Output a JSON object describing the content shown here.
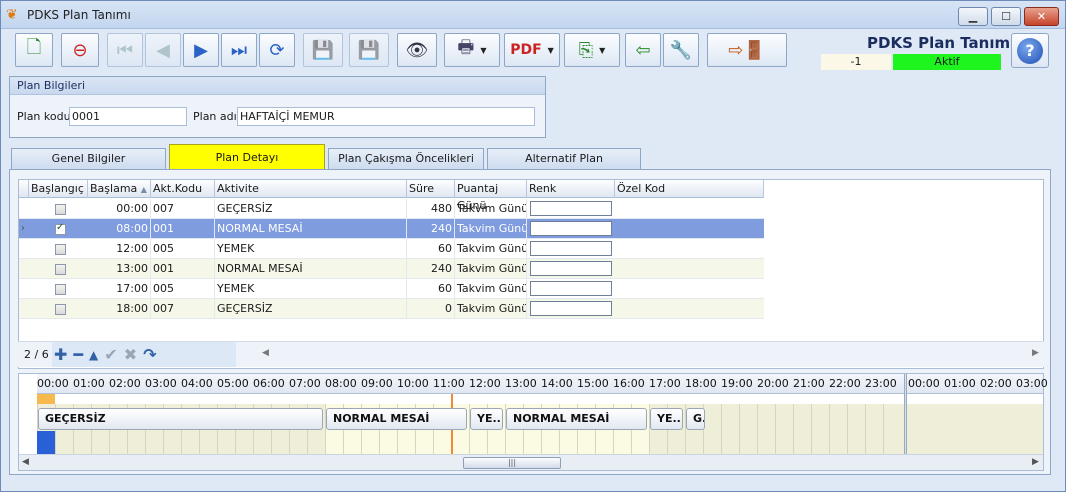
{
  "window": {
    "title": "PDKS Plan Tanımı"
  },
  "header": {
    "title": "PDKS Plan Tanımı",
    "record_no": "-1",
    "status": "Aktif",
    "status_color": "#1ef51e"
  },
  "toolbar": {
    "icons": [
      "new-icon",
      "delete-icon",
      "first-icon",
      "prev-icon",
      "next-icon",
      "last-icon",
      "refresh-icon",
      "save-icon",
      "save-cancel-icon",
      "preview-icon",
      "print-icon",
      "pdf-export-icon",
      "copy-icon",
      "import-icon",
      "tools-icon",
      "exit-icon",
      "help-icon"
    ]
  },
  "plan_info": {
    "group_title": "Plan Bilgileri",
    "code_label": "Plan kodu",
    "code_value": "0001",
    "name_label": "Plan adı",
    "name_value": "HAFTAİÇİ MEMUR"
  },
  "tabs": [
    "Genel Bilgiler",
    "Plan Detayı",
    "Plan Çakışma Öncelikleri",
    "Alternatif Plan"
  ],
  "grid": {
    "columns": [
      "Başlangıç",
      "Başlama",
      "Akt.Kodu",
      "Aktivite",
      "Süre",
      "Puantaj Günü",
      "Renk",
      "Özel Kod"
    ],
    "rows": [
      {
        "start": false,
        "time": "00:00",
        "code": "007",
        "activity": "GEÇERSİZ",
        "dur": "480",
        "day": "Takvim Günü"
      },
      {
        "start": true,
        "time": "08:00",
        "code": "001",
        "activity": "NORMAL MESAİ",
        "dur": "240",
        "day": "Takvim Günü"
      },
      {
        "start": false,
        "time": "12:00",
        "code": "005",
        "activity": "YEMEK",
        "dur": "60",
        "day": "Takvim Günü"
      },
      {
        "start": false,
        "time": "13:00",
        "code": "001",
        "activity": "NORMAL MESAİ",
        "dur": "240",
        "day": "Takvim Günü"
      },
      {
        "start": false,
        "time": "17:00",
        "code": "005",
        "activity": "YEMEK",
        "dur": "60",
        "day": "Takvim Günü"
      },
      {
        "start": false,
        "time": "18:00",
        "code": "007",
        "activity": "GEÇERSİZ",
        "dur": "0",
        "day": "Takvim Günü"
      }
    ],
    "selected_index": 1
  },
  "navigator": {
    "count": "2 / 6"
  },
  "timeline": {
    "hours": [
      "00:00",
      "01:00",
      "02:00",
      "03:00",
      "04:00",
      "05:00",
      "06:00",
      "07:00",
      "08:00",
      "09:00",
      "10:00",
      "11:00",
      "12:00",
      "13:00",
      "14:00",
      "15:00",
      "16:00",
      "17:00",
      "18:00",
      "19:00",
      "20:00",
      "21:00",
      "22:00",
      "23:00"
    ],
    "next_hours": [
      "00:00",
      "01:00",
      "02:00",
      "03:00"
    ],
    "blocks": [
      {
        "label": "GEÇERSİZ",
        "start": 0,
        "end": 8
      },
      {
        "label": "NORMAL MESAİ",
        "start": 8,
        "end": 12
      },
      {
        "label": "YE...",
        "start": 12,
        "end": 13
      },
      {
        "label": "NORMAL MESAİ",
        "start": 13,
        "end": 17
      },
      {
        "label": "YE...",
        "start": 17,
        "end": 18
      },
      {
        "label": "G.",
        "start": 18,
        "end": 18.6
      }
    ]
  }
}
